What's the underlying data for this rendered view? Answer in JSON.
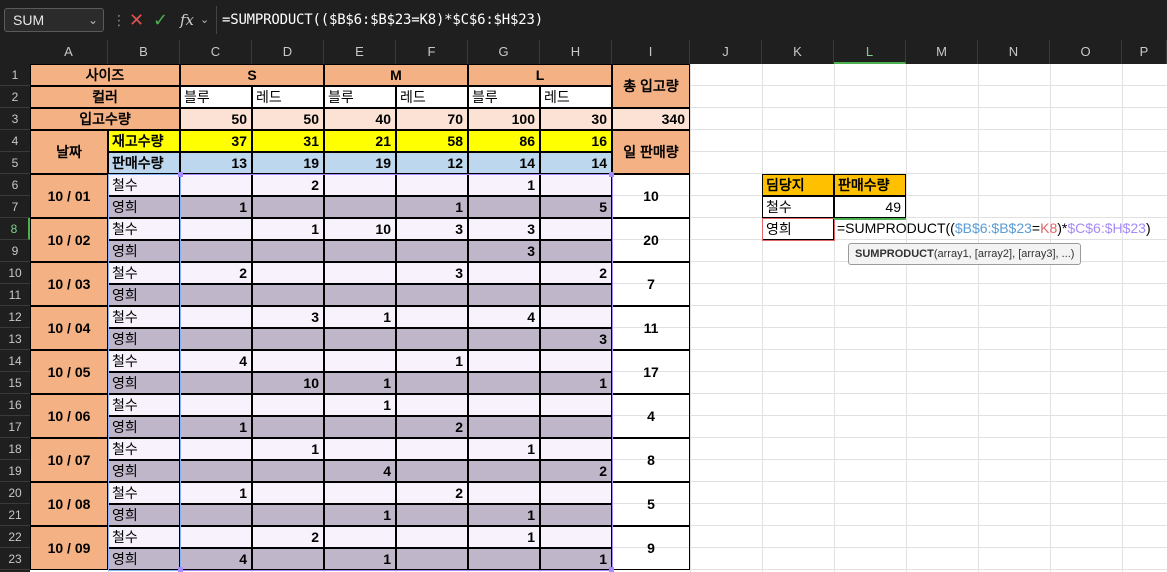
{
  "formula_bar": {
    "name_box": "SUM",
    "cancel_icon": "close-icon",
    "enter_icon": "check-icon",
    "fx_label": "fx",
    "formula": "=SUMPRODUCT(($B$6:$B$23=K8)*$C$6:$H$23)"
  },
  "columns": [
    "A",
    "B",
    "C",
    "D",
    "E",
    "F",
    "G",
    "H",
    "I",
    "J",
    "K",
    "L",
    "M",
    "N",
    "O",
    "P"
  ],
  "selected_column": "L",
  "rows": [
    "1",
    "2",
    "3",
    "4",
    "5",
    "6",
    "7",
    "8",
    "9",
    "10",
    "11",
    "12",
    "13",
    "14",
    "15",
    "16",
    "17",
    "18",
    "19",
    "20",
    "21",
    "22",
    "23"
  ],
  "selected_row": "8",
  "table": {
    "size_label": "사이즈",
    "color_label": "컬러",
    "inbound_label": "입고수량",
    "date_label": "날짜",
    "stock_label": "재고수량",
    "sales_label": "판매수량",
    "total_inbound_label": "총 입고량",
    "daily_sales_label": "일 판매량",
    "sizes": [
      "S",
      "M",
      "L"
    ],
    "colors": [
      "블루",
      "레드",
      "블루",
      "레드",
      "블루",
      "레드"
    ],
    "inbound": [
      "50",
      "50",
      "40",
      "70",
      "100",
      "30"
    ],
    "total_inbound": "340",
    "stock": [
      "37",
      "31",
      "21",
      "58",
      "86",
      "16"
    ],
    "sales": [
      "13",
      "19",
      "19",
      "12",
      "14",
      "14"
    ],
    "days": [
      {
        "date": "10 / 01",
        "total": "10",
        "rows": [
          {
            "name": "철수",
            "vals": [
              "",
              "2",
              "",
              "",
              "1",
              ""
            ]
          },
          {
            "name": "영희",
            "vals": [
              "1",
              "",
              "",
              "1",
              "",
              "5"
            ]
          }
        ]
      },
      {
        "date": "10 / 02",
        "total": "20",
        "rows": [
          {
            "name": "철수",
            "vals": [
              "",
              "1",
              "10",
              "3",
              "3",
              ""
            ]
          },
          {
            "name": "영희",
            "vals": [
              "",
              "",
              "",
              "",
              "3",
              ""
            ]
          }
        ]
      },
      {
        "date": "10 / 03",
        "total": "7",
        "rows": [
          {
            "name": "철수",
            "vals": [
              "2",
              "",
              "",
              "3",
              "",
              "2"
            ]
          },
          {
            "name": "영희",
            "vals": [
              "",
              "",
              "",
              "",
              "",
              ""
            ]
          }
        ]
      },
      {
        "date": "10 / 04",
        "total": "11",
        "rows": [
          {
            "name": "철수",
            "vals": [
              "",
              "3",
              "1",
              "",
              "4",
              ""
            ]
          },
          {
            "name": "영희",
            "vals": [
              "",
              "",
              "",
              "",
              "",
              "3"
            ]
          }
        ]
      },
      {
        "date": "10 / 05",
        "total": "17",
        "rows": [
          {
            "name": "철수",
            "vals": [
              "4",
              "",
              "",
              "1",
              "",
              ""
            ]
          },
          {
            "name": "영희",
            "vals": [
              "",
              "10",
              "1",
              "",
              "",
              "1"
            ]
          }
        ]
      },
      {
        "date": "10 / 06",
        "total": "4",
        "rows": [
          {
            "name": "철수",
            "vals": [
              "",
              "",
              "1",
              "",
              "",
              ""
            ]
          },
          {
            "name": "영희",
            "vals": [
              "1",
              "",
              "",
              "2",
              "",
              ""
            ]
          }
        ]
      },
      {
        "date": "10 / 07",
        "total": "8",
        "rows": [
          {
            "name": "철수",
            "vals": [
              "",
              "1",
              "",
              "",
              "1",
              ""
            ]
          },
          {
            "name": "영희",
            "vals": [
              "",
              "",
              "4",
              "",
              "",
              "2"
            ]
          }
        ]
      },
      {
        "date": "10 / 08",
        "total": "5",
        "rows": [
          {
            "name": "철수",
            "vals": [
              "1",
              "",
              "",
              "2",
              "",
              ""
            ]
          },
          {
            "name": "영희",
            "vals": [
              "",
              "",
              "1",
              "",
              "1",
              ""
            ]
          }
        ]
      },
      {
        "date": "10 / 09",
        "total": "9",
        "rows": [
          {
            "name": "철수",
            "vals": [
              "",
              "2",
              "",
              "",
              "1",
              ""
            ]
          },
          {
            "name": "영희",
            "vals": [
              "4",
              "",
              "1",
              "",
              "",
              "1"
            ]
          }
        ]
      }
    ]
  },
  "summary": {
    "header_person": "딤당지",
    "header_sales": "판매수량",
    "row1_name": "철수",
    "row1_value": "49",
    "row2_name": "영희"
  },
  "editing": {
    "prefix": "=SUMPRODUCT((",
    "ref1": "$B$6:$B$23",
    "eq": "=",
    "ref2": "K8",
    "mid": ")*",
    "ref3": "$C$6:$H$23",
    "suffix": ")"
  },
  "tooltip": {
    "func": "SUMPRODUCT",
    "args": "(array1, [array2], [array3], ...)"
  },
  "colors": {
    "header_orange": "#f4b184",
    "stock_yellow": "#ffff00",
    "sales_blue": "#bdd7ee",
    "summary_header": "#ffc000",
    "range_purple": "#a78bfa",
    "range_blue": "#5b9bd5",
    "range_red": "#e06666"
  }
}
